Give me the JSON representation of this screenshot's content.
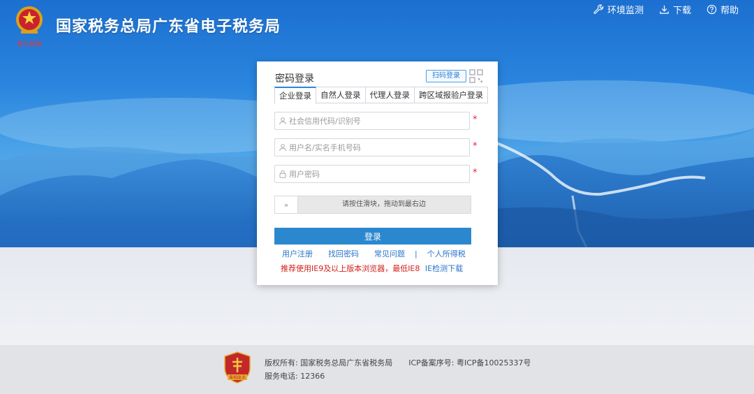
{
  "header": {
    "title": "国家税务总局广东省电子税务局",
    "emblem_caption": "青为民族",
    "nav": [
      {
        "label": "环境监测",
        "icon": "wrench-icon"
      },
      {
        "label": "下载",
        "icon": "download-icon"
      },
      {
        "label": "帮助",
        "icon": "help-icon"
      }
    ]
  },
  "login": {
    "title": "密码登录",
    "qr_label": "扫码登录",
    "tabs": [
      "企业登录",
      "自然人登录",
      "代理人登录",
      "跨区域报验户登录"
    ],
    "fields": {
      "credit_code": {
        "placeholder": "社会信用代码/识别号",
        "value": ""
      },
      "username": {
        "placeholder": "用户名/实名手机号码",
        "value": ""
      },
      "password": {
        "placeholder": "用户密码",
        "value": ""
      }
    },
    "required_mark": "*",
    "slider": {
      "handle": "»",
      "text": "请按住滑块，拖动到最右边"
    },
    "submit_label": "登录",
    "links": [
      "用户注册",
      "找回密码",
      "常见问题",
      "个人所得税"
    ],
    "link_separator": "|",
    "notice": "推荐使用IE9及以上版本浏览器，最低IE8",
    "notice_link": "IE检测下载"
  },
  "footer": {
    "copyright_label": "版权所有:",
    "copyright_value": "国家税务总局广东省税务局",
    "icp_label": "ICP备案序号:",
    "icp_value": "粤ICP备10025337号",
    "phone_label": "服务电话:",
    "phone_value": "12366",
    "logo_caption": "青税航关"
  },
  "colors": {
    "banner_blue": "#2a86de",
    "button_blue": "#2b88cf",
    "link_blue": "#2a74c9",
    "warning_red": "#d2221c"
  }
}
